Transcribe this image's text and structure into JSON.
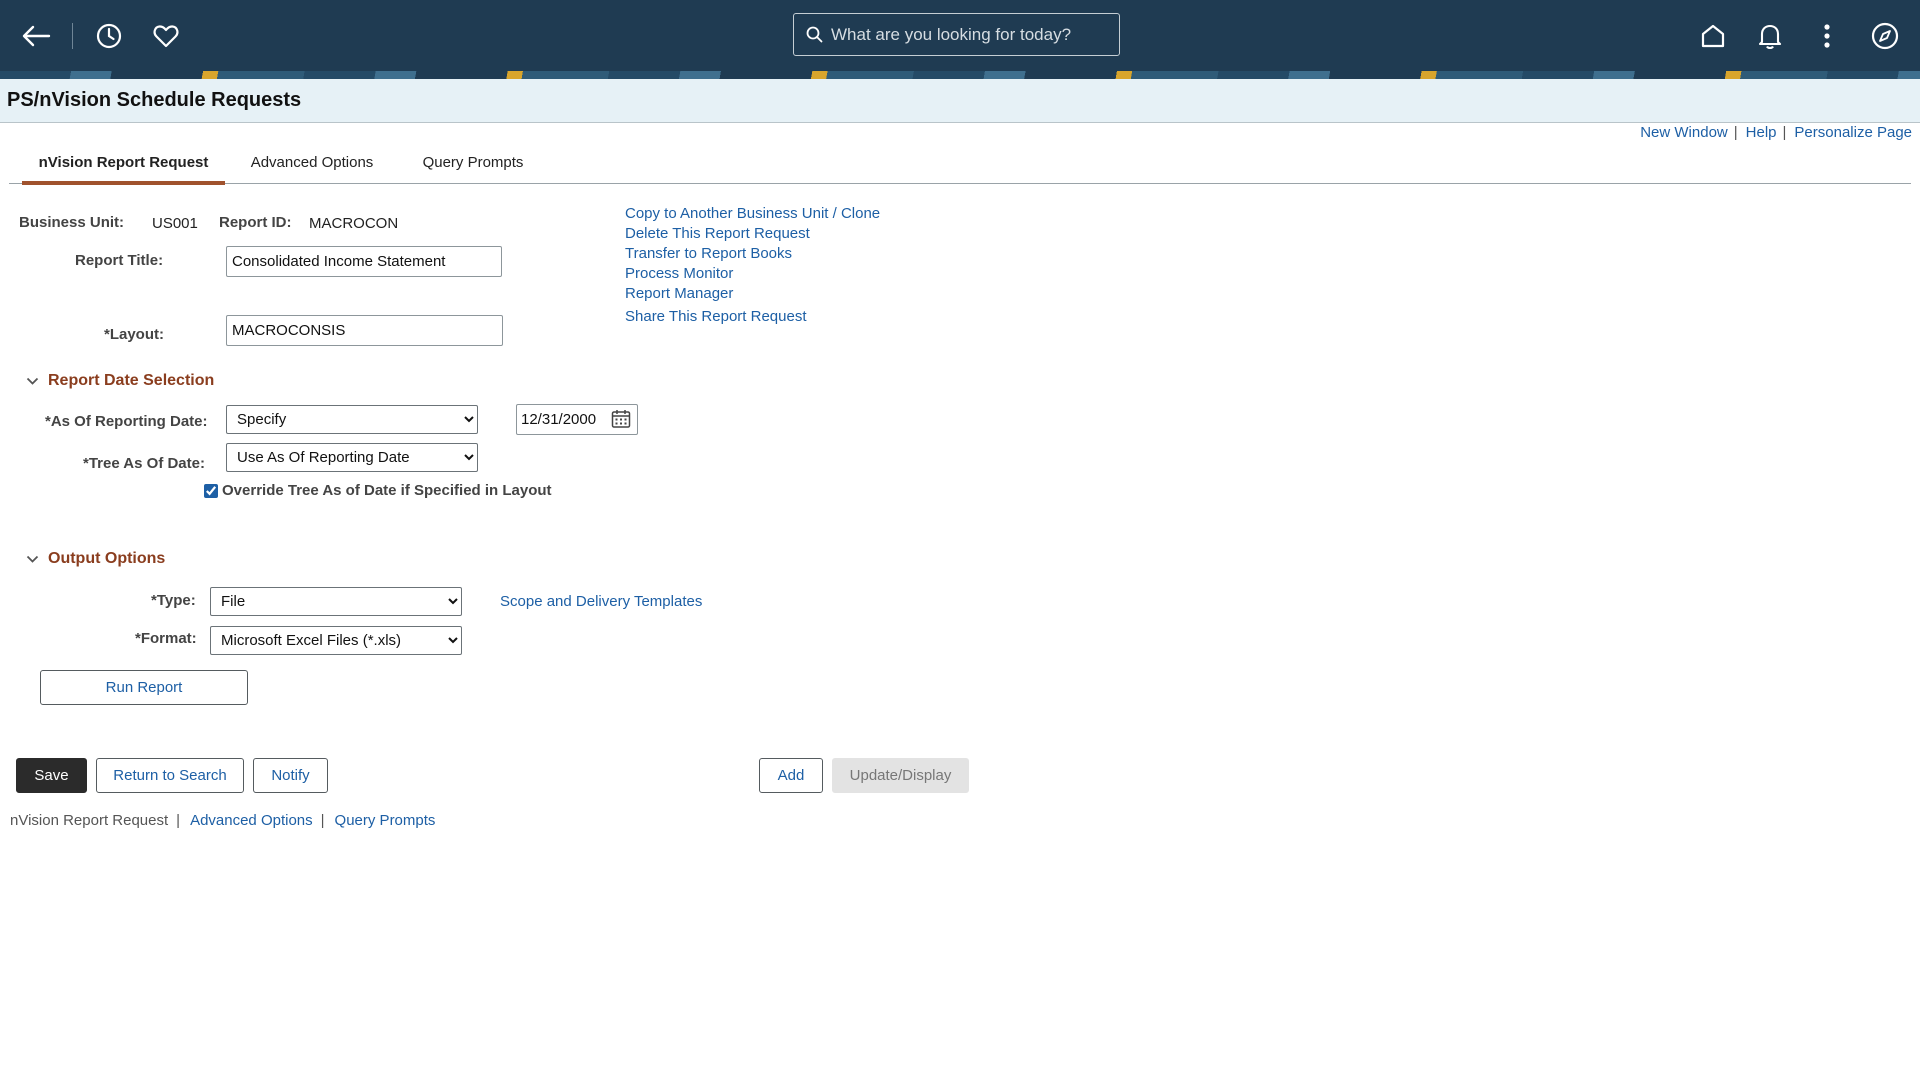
{
  "header": {
    "search_placeholder": "What are you looking for today?",
    "brand_color": "#1f3b52"
  },
  "page": {
    "title": "PS/nVision Schedule Requests"
  },
  "top_links": {
    "new_window": "New Window",
    "help": "Help",
    "personalize": "Personalize Page",
    "sep": "|"
  },
  "tabs": [
    {
      "label": "nVision Report Request",
      "active": true
    },
    {
      "label": "Advanced Options",
      "active": false
    },
    {
      "label": "Query Prompts",
      "active": false
    }
  ],
  "form": {
    "business_unit_label": "Business Unit:",
    "business_unit_value": "US001",
    "report_id_label": "Report ID:",
    "report_id_value": "MACROCON",
    "report_title_label": "Report Title:",
    "report_title_value": "Consolidated Income Statement",
    "layout_label": "*Layout:",
    "layout_value": "MACROCONSIS"
  },
  "actions_links": [
    "Copy to Another Business Unit / Clone",
    "Delete This Report Request",
    "Transfer to Report Books",
    "Process Monitor",
    "Report Manager",
    "Share This Report Request"
  ],
  "date_section": {
    "title": "Report Date Selection",
    "as_of_label": "*As Of Reporting Date:",
    "as_of_value": "Specify",
    "date_value": "12/31/2000",
    "tree_label": "*Tree As Of Date:",
    "tree_value": "Use As Of Reporting Date",
    "override_label": "Override Tree As of Date if Specified in Layout",
    "override_checked": true
  },
  "output_section": {
    "title": "Output Options",
    "type_label": "*Type:",
    "type_value": "File",
    "format_label": "*Format:",
    "format_value": "Microsoft Excel Files (*.xls)",
    "scope_link": "Scope and Delivery Templates",
    "run_button": "Run Report"
  },
  "buttons": {
    "save": "Save",
    "return_to_search": "Return to Search",
    "notify": "Notify",
    "add": "Add",
    "update_display": "Update/Display"
  },
  "footer_nav": {
    "current": "nVision Report Request",
    "advanced": "Advanced Options",
    "query": "Query Prompts",
    "sep": "|"
  }
}
